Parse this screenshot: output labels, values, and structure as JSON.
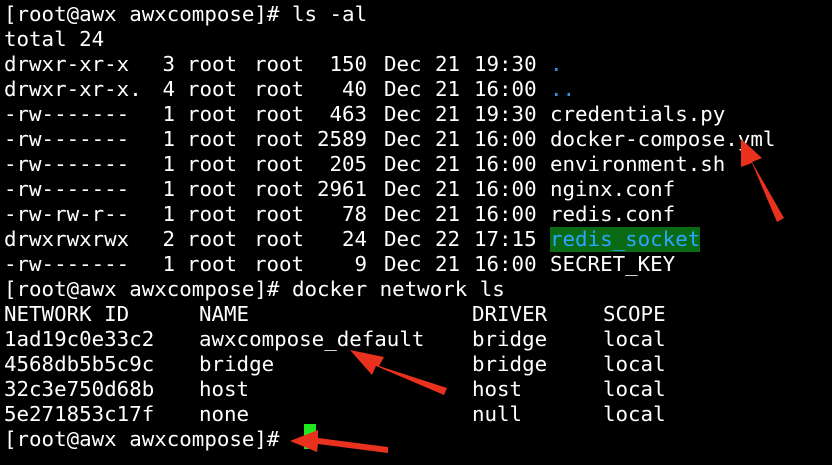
{
  "terminal": {
    "prompt_1": "[root@awx awxcompose]# ls -al",
    "total_line": "total 24",
    "listing": [
      {
        "perms": "drwxr-xr-x ",
        "links": " 3",
        "owner": "root",
        "group": "root",
        "size": " 150",
        "month": "Dec",
        "day": "21",
        "time": "19:30",
        "name": "."
      },
      {
        "perms": "drwxr-xr-x.",
        "links": " 4",
        "owner": "root",
        "group": "root",
        "size": "  40",
        "month": "Dec",
        "day": "21",
        "time": "16:00",
        "name": ".."
      },
      {
        "perms": "-rw------- ",
        "links": " 1",
        "owner": "root",
        "group": "root",
        "size": " 463",
        "month": "Dec",
        "day": "21",
        "time": "19:30",
        "name": "credentials.py"
      },
      {
        "perms": "-rw------- ",
        "links": " 1",
        "owner": "root",
        "group": "root",
        "size": "2589",
        "month": "Dec",
        "day": "21",
        "time": "16:00",
        "name": "docker-compose.yml"
      },
      {
        "perms": "-rw------- ",
        "links": " 1",
        "owner": "root",
        "group": "root",
        "size": " 205",
        "month": "Dec",
        "day": "21",
        "time": "16:00",
        "name": "environment.sh"
      },
      {
        "perms": "-rw------- ",
        "links": " 1",
        "owner": "root",
        "group": "root",
        "size": "2961",
        "month": "Dec",
        "day": "21",
        "time": "16:00",
        "name": "nginx.conf"
      },
      {
        "perms": "-rw-rw-r-- ",
        "links": " 1",
        "owner": "root",
        "group": "root",
        "size": "  78",
        "month": "Dec",
        "day": "21",
        "time": "16:00",
        "name": "redis.conf"
      },
      {
        "perms": "drwxrwxrwx ",
        "links": " 2",
        "owner": "root",
        "group": "root",
        "size": "  24",
        "month": "Dec",
        "day": "22",
        "time": "17:15",
        "name": "redis_socket"
      },
      {
        "perms": "-rw------- ",
        "links": " 1",
        "owner": "root",
        "group": "root",
        "size": "   9",
        "month": "Dec",
        "day": "21",
        "time": "16:00",
        "name": "SECRET_KEY"
      }
    ],
    "prompt_2": "[root@awx awxcompose]# docker network ls",
    "network_headers": {
      "id": "NETWORK ID",
      "name": "NAME",
      "driver": "DRIVER",
      "scope": "SCOPE"
    },
    "networks": [
      {
        "id": "1ad19c0e33c2",
        "name": "awxcompose_default",
        "driver": "bridge",
        "scope": "local"
      },
      {
        "id": "4568db5b5c9c",
        "name": "bridge",
        "driver": "bridge",
        "scope": "local"
      },
      {
        "id": "32c3e750d68b",
        "name": "host",
        "driver": "host",
        "scope": "local"
      },
      {
        "id": "5e271853c17f",
        "name": "none",
        "driver": "null",
        "scope": "local"
      }
    ],
    "prompt_3": "[root@awx awxcompose]#"
  },
  "colors": {
    "background": "#000000",
    "text": "#ffffff",
    "directory": "#3a8ee6",
    "highlight_bg": "#0b6b14",
    "cursor": "#21e81e",
    "arrow": "#e8321e"
  }
}
